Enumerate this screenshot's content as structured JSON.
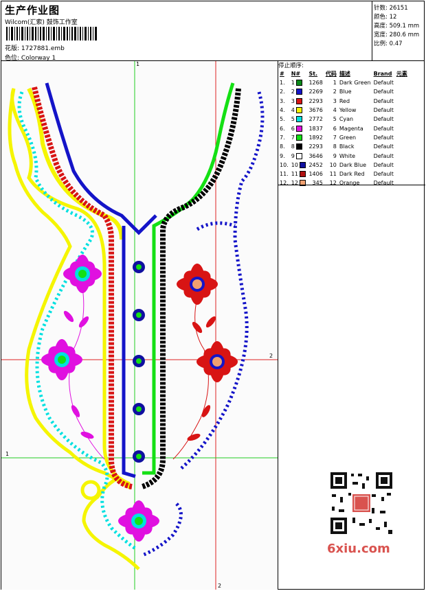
{
  "header": {
    "title": "生产作业图",
    "company": "Wilcom(汇索) 鼓饰工作室",
    "pattern_label": "花版:",
    "pattern_value": "1727881.emb",
    "colorway_label": "色位:",
    "colorway_value": "Colorway 1"
  },
  "stats": {
    "stitches_label": "针数:",
    "stitches": "26151",
    "colors_label": "颜色:",
    "colors": "12",
    "height_label": "高度:",
    "height": "509.1 mm",
    "width_label": "宽度:",
    "width": "280.6 mm",
    "scale_label": "比例:",
    "scale": "0.47"
  },
  "stop_sequence": {
    "title": "停止顺序:",
    "columns": [
      "#",
      "N#",
      "St.",
      "代码",
      "描述",
      "Brand",
      "元素"
    ],
    "rows": [
      {
        "idx": "1.",
        "n": "1",
        "st": "1268",
        "code": "1",
        "desc": "Dark Green",
        "brand": "Default",
        "color": "#0a8a1a"
      },
      {
        "idx": "2.",
        "n": "2",
        "st": "2269",
        "code": "2",
        "desc": "Blue",
        "brand": "Default",
        "color": "#1414c8"
      },
      {
        "idx": "3.",
        "n": "3",
        "st": "2293",
        "code": "3",
        "desc": "Red",
        "brand": "Default",
        "color": "#d81414"
      },
      {
        "idx": "4.",
        "n": "4",
        "st": "3676",
        "code": "4",
        "desc": "Yellow",
        "brand": "Default",
        "color": "#f5f500"
      },
      {
        "idx": "5.",
        "n": "5",
        "st": "2772",
        "code": "5",
        "desc": "Cyan",
        "brand": "Default",
        "color": "#00e0e0"
      },
      {
        "idx": "6.",
        "n": "6",
        "st": "1837",
        "code": "6",
        "desc": "Magenta",
        "brand": "Default",
        "color": "#e010e0"
      },
      {
        "idx": "7.",
        "n": "7",
        "st": "1892",
        "code": "7",
        "desc": "Green",
        "brand": "Default",
        "color": "#14e014"
      },
      {
        "idx": "8.",
        "n": "8",
        "st": "2293",
        "code": "8",
        "desc": "Black",
        "brand": "Default",
        "color": "#000000"
      },
      {
        "idx": "9.",
        "n": "9",
        "st": "3646",
        "code": "9",
        "desc": "White",
        "brand": "Default",
        "color": "#ffffff"
      },
      {
        "idx": "10.",
        "n": "10",
        "st": "2452",
        "code": "10",
        "desc": "Dark Blue",
        "brand": "Default",
        "color": "#1010a0"
      },
      {
        "idx": "11.",
        "n": "11",
        "st": "1406",
        "code": "11",
        "desc": "Dark Red",
        "brand": "Default",
        "color": "#b01010"
      },
      {
        "idx": "12.",
        "n": "12",
        "st": "345",
        "code": "12",
        "desc": "Orange",
        "brand": "Default",
        "color": "#f0a070"
      }
    ]
  },
  "axes": {
    "v1": "1",
    "v2": "2",
    "h1": "1",
    "h2": "2"
  },
  "watermark": "6xiu.com",
  "colors": {
    "guide_green": "#22cc22",
    "guide_red": "#dd2222"
  }
}
